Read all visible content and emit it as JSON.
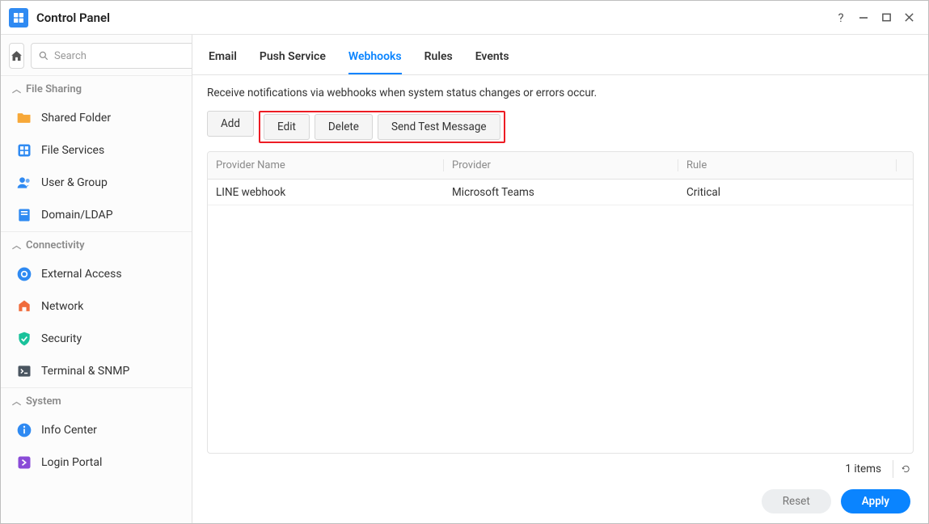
{
  "window": {
    "title": "Control Panel"
  },
  "search": {
    "placeholder": "Search"
  },
  "sidebar": {
    "sections": [
      {
        "label": "File Sharing",
        "items": [
          {
            "label": "Shared Folder",
            "icon": "folder",
            "color": "#f7a838"
          },
          {
            "label": "File Services",
            "icon": "file-grid",
            "color": "#2f8af2"
          },
          {
            "label": "User & Group",
            "icon": "users",
            "color": "#2f8af2"
          },
          {
            "label": "Domain/LDAP",
            "icon": "book",
            "color": "#2f8af2"
          }
        ]
      },
      {
        "label": "Connectivity",
        "items": [
          {
            "label": "External Access",
            "icon": "link",
            "color": "#2f8af2"
          },
          {
            "label": "Network",
            "icon": "globe-home",
            "color": "#f06c3c"
          },
          {
            "label": "Security",
            "icon": "shield",
            "color": "#19c29b"
          },
          {
            "label": "Terminal & SNMP",
            "icon": "terminal",
            "color": "#4a5560"
          }
        ]
      },
      {
        "label": "System",
        "items": [
          {
            "label": "Info Center",
            "icon": "info",
            "color": "#2f8af2"
          },
          {
            "label": "Login Portal",
            "icon": "portal",
            "color": "#8a4bd7"
          }
        ]
      }
    ]
  },
  "tabs": [
    {
      "label": "Email"
    },
    {
      "label": "Push Service"
    },
    {
      "label": "Webhooks",
      "active": true
    },
    {
      "label": "Rules"
    },
    {
      "label": "Events"
    }
  ],
  "content": {
    "description": "Receive notifications via webhooks when system status changes or errors occur.",
    "buttons": {
      "add": "Add",
      "edit": "Edit",
      "delete": "Delete",
      "send_test": "Send Test Message"
    },
    "columns": [
      "Provider Name",
      "Provider",
      "Rule"
    ],
    "rows": [
      {
        "provider_name": "LINE  webhook",
        "provider": "Microsoft Teams",
        "rule": "Critical"
      }
    ],
    "status": "1 items"
  },
  "footer": {
    "reset": "Reset",
    "apply": "Apply"
  }
}
